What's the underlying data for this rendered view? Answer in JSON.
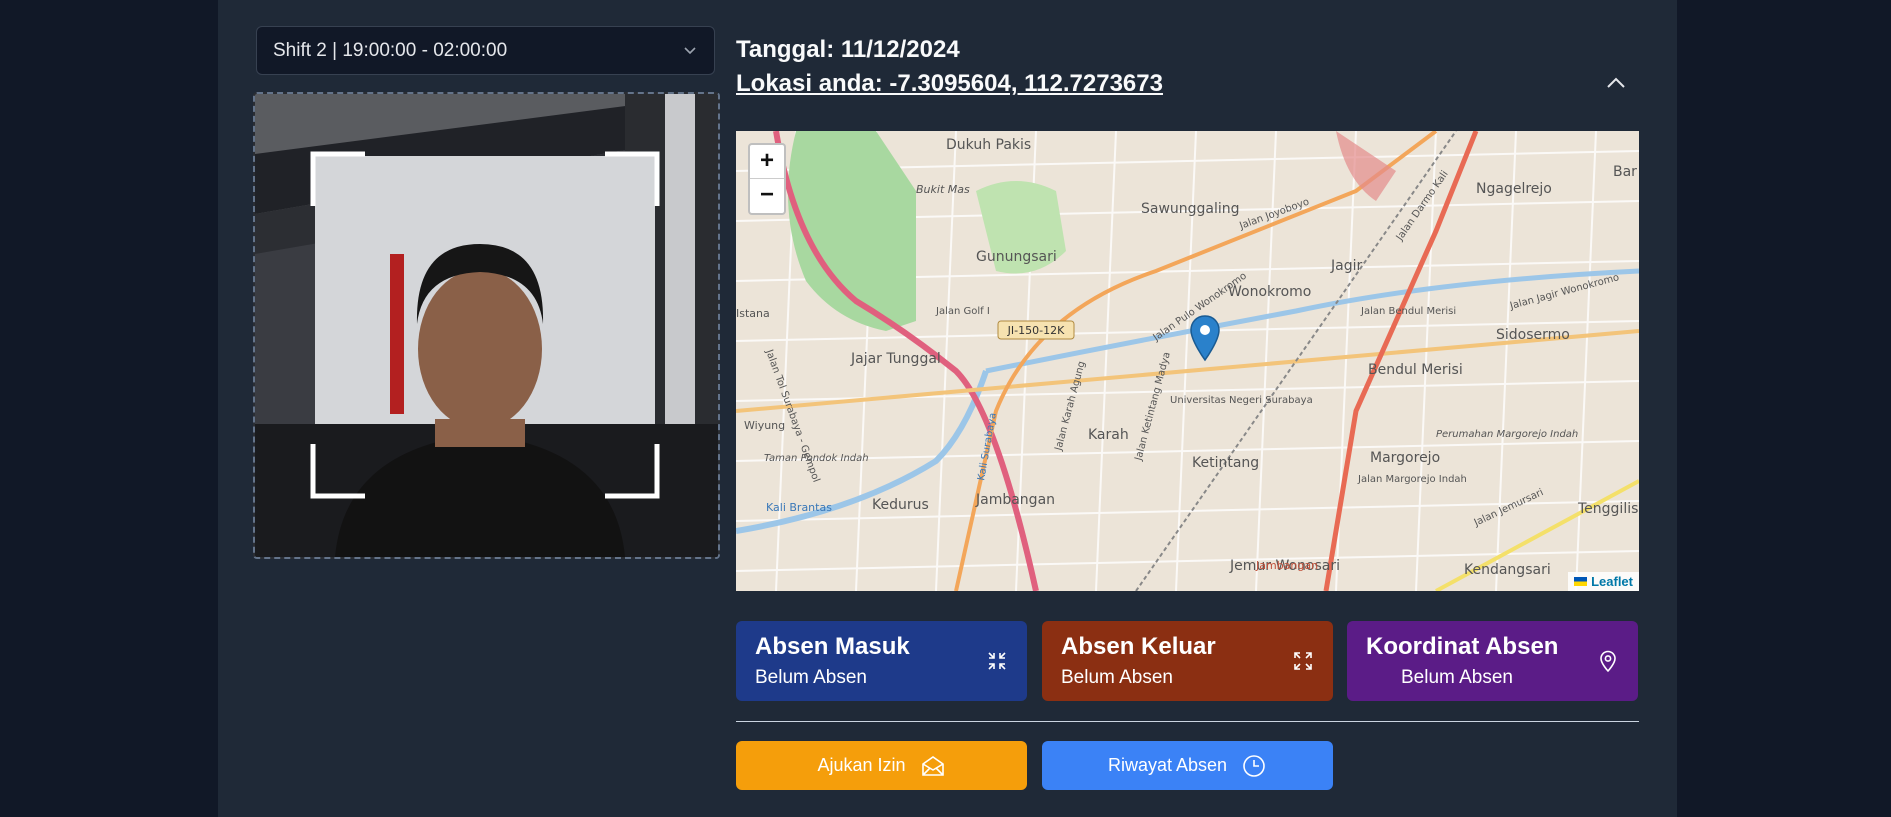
{
  "shift": {
    "selected": "Shift 2 | 19:00:00 - 02:00:00"
  },
  "info": {
    "date": "Tanggal: 11/12/2024",
    "location": "Lokasi anda: -7.3095604, 112.7273673"
  },
  "map": {
    "zoom_in": "+",
    "zoom_out": "−",
    "attribution": "Leaflet",
    "labels": [
      "Dukuh Pakis",
      "Bukit Mas",
      "Gunungsari",
      "Sawunggaling",
      "Jalan Joyoboyo",
      "Wonokromo",
      "Ngagelrejo",
      "Jagir",
      "Jalan Jagir Wonokromo",
      "Jalan Bendul Merisi",
      "Sidosermo",
      "Bendul Merisi",
      "Jalan Golf I",
      "JI-150-12K",
      "Jajar Tunggal",
      "Jalan Tol Surabaya - Gempol",
      "Wiyung",
      "Istana",
      "Karah",
      "Universitas Negeri Surabaya",
      "Ketintang",
      "Margorejo",
      "Perumahan Margorejo Indah",
      "Jalan Margorejo Indah",
      "Tenggilis M",
      "Kedurus",
      "Jambangan",
      "Jemur Wonosari",
      "Kendangsari",
      "Jalan Jemursari",
      "Kali Brantas",
      "Taman Pondok Indah",
      "Jalan Karah Agung",
      "Kali Surabaya",
      "Jalan Ketintang Madya",
      "Jalan Pulo Wonokromo",
      "Jalan Darmo Kali",
      "Bar"
    ]
  },
  "cards": {
    "masuk": {
      "title": "Absen Masuk",
      "status": "Belum Absen"
    },
    "keluar": {
      "title": "Absen Keluar",
      "status": "Belum Absen"
    },
    "koordinat": {
      "title": "Koordinat Absen",
      "status": "Belum Absen"
    }
  },
  "buttons": {
    "izin": "Ajukan Izin",
    "riwayat": "Riwayat Absen"
  },
  "colors": {
    "background": "#111827",
    "panel": "#1f2937",
    "card_masuk": "#1e3a8a",
    "card_keluar": "#8b2f12",
    "card_koordinat": "#5b1c87",
    "button_izin": "#f59e0b",
    "button_riwayat": "#3b82f6",
    "map_pin": "#2a81cb"
  }
}
